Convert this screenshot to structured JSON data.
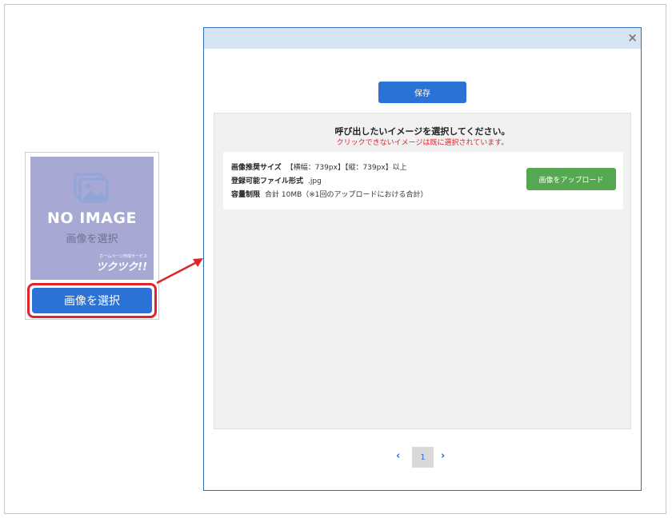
{
  "card": {
    "placeholder_main": "NO IMAGE",
    "placeholder_sub": "画像を選択",
    "logo_text": "ツクツク!!",
    "logo_sub": "ホームページ作成サービス",
    "select_button": "画像を選択"
  },
  "modal": {
    "close_symbol": "×",
    "save_button": "保存",
    "title": "呼び出したいイメージを選択してください。",
    "warning": "クリックできないイメージは既に選択されています。",
    "info": {
      "size_label": "画像推奨サイズ",
      "size_value": "【横幅：739px】【縦：739px】以上",
      "format_label": "登録可能ファイル形式",
      "format_value": ".jpg",
      "limit_label": "容量制限",
      "limit_value": "合計 10MB（※1回のアップロードにおける合計）"
    },
    "upload_button": "画像をアップロード",
    "pagination": {
      "prev": "‹",
      "current": "1",
      "next": "›"
    }
  },
  "colors": {
    "accent_blue": "#2b72d6",
    "highlight_red": "#e0242b",
    "upload_green": "#55a84f",
    "modal_header": "#d7e4f4"
  }
}
